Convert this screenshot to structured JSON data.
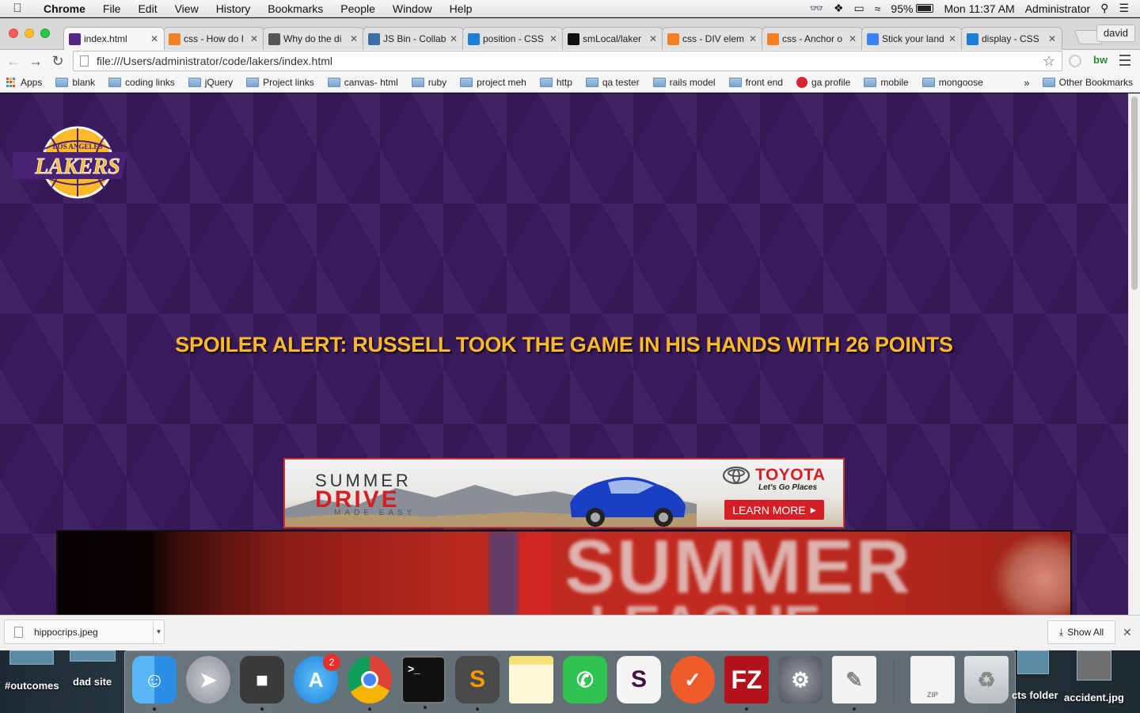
{
  "menubar": {
    "app_name": "Chrome",
    "items": [
      "File",
      "Edit",
      "View",
      "History",
      "Bookmarks",
      "People",
      "Window",
      "Help"
    ],
    "battery": "95%",
    "clock": "Mon 11:37 AM",
    "user": "Administrator"
  },
  "tabs": [
    {
      "title": "index.html",
      "active": true,
      "favicon": "lakers-favicon"
    },
    {
      "title": "css - How do I",
      "active": false,
      "favicon": "stackoverflow-favicon"
    },
    {
      "title": "Why do the di",
      "active": false,
      "favicon": "code-favicon"
    },
    {
      "title": "JS Bin - Collab",
      "active": false,
      "favicon": "jsbin-favicon"
    },
    {
      "title": "position - CSS",
      "active": false,
      "favicon": "mdn-favicon"
    },
    {
      "title": "smLocal/laker",
      "active": false,
      "favicon": "github-favicon"
    },
    {
      "title": "css - DIV elem",
      "active": false,
      "favicon": "stackoverflow-favicon"
    },
    {
      "title": "css - Anchor o",
      "active": false,
      "favicon": "stackoverflow-favicon"
    },
    {
      "title": "Stick your land",
      "active": false,
      "favicon": "gear-favicon"
    },
    {
      "title": "display - CSS",
      "active": false,
      "favicon": "mdn-favicon"
    }
  ],
  "profile_name": "david",
  "address_bar": {
    "url": "file:///Users/administrator/code/lakers/index.html"
  },
  "bookmarks": {
    "apps_label": "Apps",
    "items": [
      "blank",
      "coding links",
      "jQuery",
      "Project links",
      "canvas- html",
      "ruby",
      "project meh",
      "http",
      "qa tester",
      "rails model",
      "front end",
      "ga profile",
      "mobile",
      "mongoose"
    ],
    "overflow": "»",
    "other": "Other Bookmarks"
  },
  "page": {
    "logo_text_top": "LOS ANGELES",
    "logo_text_main": "LAKERS",
    "headline": "SPOILER ALERT: RUSSELL TOOK THE GAME IN HIS HANDS WITH 26 POINTS",
    "ad": {
      "line1": "SUMMER",
      "line2": "DRIVE",
      "line3": "MADE EASY",
      "brand": "TOYOTA",
      "tagline": "Let's Go Places",
      "cta": "LEARN MORE"
    },
    "video_text_1": "SUMMER",
    "video_text_2": "LEAGUE"
  },
  "download_bar": {
    "filename": "hippocrips.jpeg",
    "show_all": "Show All"
  },
  "desktop": {
    "icons": [
      "#outcomes",
      "dad site",
      "cts folder",
      "accident.jpg"
    ]
  },
  "dock": {
    "app_store_badge": "2",
    "zip_label": "ZIP"
  },
  "colors": {
    "lakers_purple": "#3a1a5c",
    "lakers_gold": "#fdb927",
    "toyota_red": "#d51f26"
  }
}
